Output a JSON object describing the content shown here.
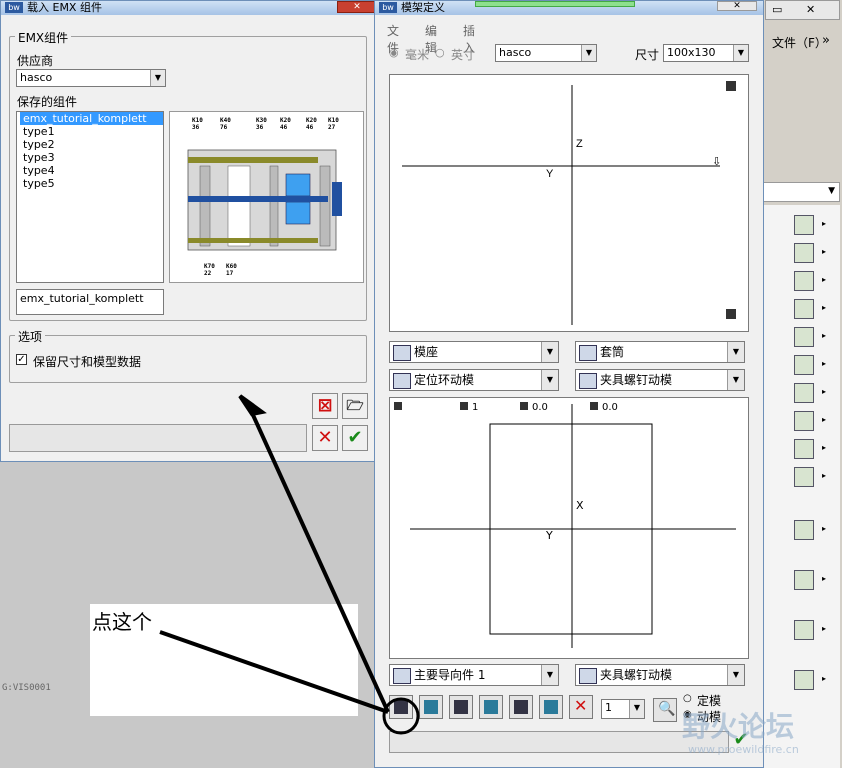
{
  "emx_dialog": {
    "title": "载入 EMX 组件",
    "title_icon": "bw",
    "group_label": "EMX组件",
    "supplier_label": "供应商",
    "supplier_value": "hasco",
    "saved_label": "保存的组件",
    "saved_items": [
      "emx_tutorial_komplett",
      "type1",
      "type2",
      "type3",
      "type4",
      "type5"
    ],
    "selected_item": "emx_tutorial_komplett",
    "name_value": "emx_tutorial_komplett",
    "options_label": "选项",
    "keep_label": "保留尺寸和模型数据",
    "keep_checked": true,
    "preview_labels_top": [
      "K10\n36",
      "K40\n76",
      "K30\n36",
      "K20\n46",
      "K20\n46",
      "K10\n27"
    ],
    "preview_labels_bottom": [
      "K70\n22",
      "K60\n17"
    ]
  },
  "mold_dialog": {
    "title": "模架定义",
    "title_icon": "bw",
    "menu": [
      "文件",
      "编辑",
      "插入"
    ],
    "unit_mm": "毫米",
    "unit_inch": "英寸",
    "supplier_value": "hasco",
    "size_label": "尺寸",
    "size_value": "100x130",
    "top_canvas": {
      "z_label": "Z",
      "y_label": "Y"
    },
    "selects_row1": [
      "模座",
      "套筒"
    ],
    "selects_row2": [
      "定位环动模",
      "夹具螺钉动模"
    ],
    "bottom_canvas": {
      "v1": "1",
      "v2": "0.0",
      "v3": "0.0",
      "x_label": "X",
      "y_label": "Y"
    },
    "selects_row3": [
      "主要导向件 1",
      "夹具螺钉动模"
    ],
    "spinner_value": "1",
    "radio_fixed": "定模",
    "radio_moving": "动模"
  },
  "right_panel": {
    "menu_label": "文件（F）",
    "chevron": "»"
  },
  "annotation": {
    "text": "点这个"
  },
  "watermark": {
    "text": "野火论坛",
    "url": "www.proewildfire.cn"
  },
  "workspace_label": "G:VIS0001",
  "colors": {
    "selection": "#3399ff",
    "ok_green": "#1a8a1a",
    "cancel_red": "#d01010",
    "part_blue": "#3ea0f0"
  }
}
